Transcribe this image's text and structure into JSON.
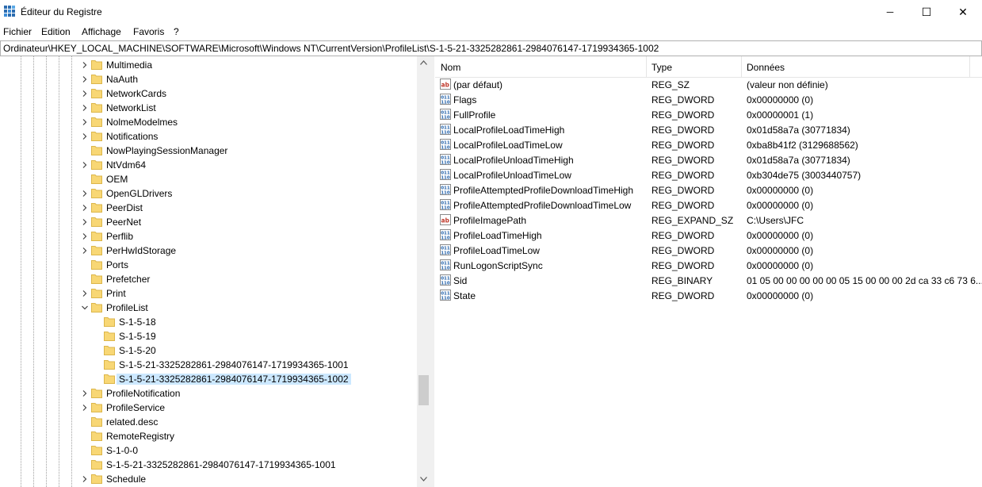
{
  "window": {
    "title": "Éditeur du Registre",
    "minimize_glyph": "─",
    "maximize_glyph": "☐",
    "close_glyph": "✕"
  },
  "menu": [
    "Fichier",
    "Edition",
    "Affichage",
    "Favoris",
    "?"
  ],
  "address": "Ordinateur\\HKEY_LOCAL_MACHINE\\SOFTWARE\\Microsoft\\Windows NT\\CurrentVersion\\ProfileList\\S-1-5-21-3325282861-2984076147-1719934365-1002",
  "tree": {
    "items": [
      {
        "label": "Multimedia",
        "expander": "collapsed"
      },
      {
        "label": "NaAuth",
        "expander": "collapsed"
      },
      {
        "label": "NetworkCards",
        "expander": "collapsed"
      },
      {
        "label": "NetworkList",
        "expander": "collapsed"
      },
      {
        "label": "NolmeModelmes",
        "expander": "collapsed"
      },
      {
        "label": "Notifications",
        "expander": "collapsed"
      },
      {
        "label": "NowPlayingSessionManager",
        "expander": "none"
      },
      {
        "label": "NtVdm64",
        "expander": "collapsed"
      },
      {
        "label": "OEM",
        "expander": "none"
      },
      {
        "label": "OpenGLDrivers",
        "expander": "collapsed"
      },
      {
        "label": "PeerDist",
        "expander": "collapsed"
      },
      {
        "label": "PeerNet",
        "expander": "collapsed"
      },
      {
        "label": "Perflib",
        "expander": "collapsed"
      },
      {
        "label": "PerHwIdStorage",
        "expander": "collapsed"
      },
      {
        "label": "Ports",
        "expander": "none"
      },
      {
        "label": "Prefetcher",
        "expander": "none"
      },
      {
        "label": "Print",
        "expander": "collapsed"
      },
      {
        "label": "ProfileList",
        "expander": "expanded"
      },
      {
        "label": "S-1-5-18",
        "expander": "none",
        "child": true
      },
      {
        "label": "S-1-5-19",
        "expander": "none",
        "child": true
      },
      {
        "label": "S-1-5-20",
        "expander": "none",
        "child": true
      },
      {
        "label": "S-1-5-21-3325282861-2984076147-1719934365-1001",
        "expander": "none",
        "child": true
      },
      {
        "label": "S-1-5-21-3325282861-2984076147-1719934365-1002",
        "expander": "none",
        "child": true,
        "selected": true
      },
      {
        "label": "ProfileNotification",
        "expander": "collapsed"
      },
      {
        "label": "ProfileService",
        "expander": "collapsed"
      },
      {
        "label": "related.desc",
        "expander": "none"
      },
      {
        "label": "RemoteRegistry",
        "expander": "none"
      },
      {
        "label": "S-1-0-0",
        "expander": "none"
      },
      {
        "label": "S-1-5-21-3325282861-2984076147-1719934365-1001",
        "expander": "none"
      },
      {
        "label": "Schedule",
        "expander": "collapsed"
      }
    ]
  },
  "list": {
    "headers": {
      "name": "Nom",
      "type": "Type",
      "data": "Données"
    },
    "rows": [
      {
        "icon": "string-value-icon",
        "name": "(par défaut)",
        "type": "REG_SZ",
        "data": "(valeur non définie)"
      },
      {
        "icon": "binary-value-icon",
        "name": "Flags",
        "type": "REG_DWORD",
        "data": "0x00000000 (0)"
      },
      {
        "icon": "binary-value-icon",
        "name": "FullProfile",
        "type": "REG_DWORD",
        "data": "0x00000001 (1)"
      },
      {
        "icon": "binary-value-icon",
        "name": "LocalProfileLoadTimeHigh",
        "type": "REG_DWORD",
        "data": "0x01d58a7a (30771834)"
      },
      {
        "icon": "binary-value-icon",
        "name": "LocalProfileLoadTimeLow",
        "type": "REG_DWORD",
        "data": "0xba8b41f2 (3129688562)"
      },
      {
        "icon": "binary-value-icon",
        "name": "LocalProfileUnloadTimeHigh",
        "type": "REG_DWORD",
        "data": "0x01d58a7a (30771834)"
      },
      {
        "icon": "binary-value-icon",
        "name": "LocalProfileUnloadTimeLow",
        "type": "REG_DWORD",
        "data": "0xb304de75 (3003440757)"
      },
      {
        "icon": "binary-value-icon",
        "name": "ProfileAttemptedProfileDownloadTimeHigh",
        "type": "REG_DWORD",
        "data": "0x00000000 (0)"
      },
      {
        "icon": "binary-value-icon",
        "name": "ProfileAttemptedProfileDownloadTimeLow",
        "type": "REG_DWORD",
        "data": "0x00000000 (0)"
      },
      {
        "icon": "string-value-icon",
        "name": "ProfileImagePath",
        "type": "REG_EXPAND_SZ",
        "data": "C:\\Users\\JFC"
      },
      {
        "icon": "binary-value-icon",
        "name": "ProfileLoadTimeHigh",
        "type": "REG_DWORD",
        "data": "0x00000000 (0)"
      },
      {
        "icon": "binary-value-icon",
        "name": "ProfileLoadTimeLow",
        "type": "REG_DWORD",
        "data": "0x00000000 (0)"
      },
      {
        "icon": "binary-value-icon",
        "name": "RunLogonScriptSync",
        "type": "REG_DWORD",
        "data": "0x00000000 (0)"
      },
      {
        "icon": "binary-value-icon",
        "name": "Sid",
        "type": "REG_BINARY",
        "data": "01 05 00 00 00 00 00 05 15 00 00 00 2d ca 33 c6 73 6..."
      },
      {
        "icon": "binary-value-icon",
        "name": "State",
        "type": "REG_DWORD",
        "data": "0x00000000 (0)"
      }
    ]
  },
  "colors": {
    "selection": "#cce8ff",
    "folder": "#f8d775",
    "folder_edge": "#dcb64a",
    "string_icon": "#c0392b",
    "binary_icon": "#1f5fa8"
  }
}
